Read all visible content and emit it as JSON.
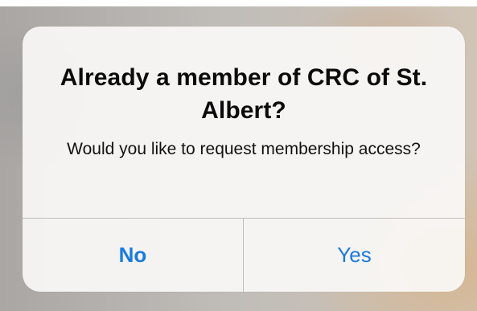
{
  "dialog": {
    "title": "Already a member of CRC of St. Albert?",
    "message": "Would you like to request membership access?",
    "buttons": {
      "no_label": "No",
      "yes_label": "Yes"
    },
    "accent_color": "#1a7ae0"
  }
}
